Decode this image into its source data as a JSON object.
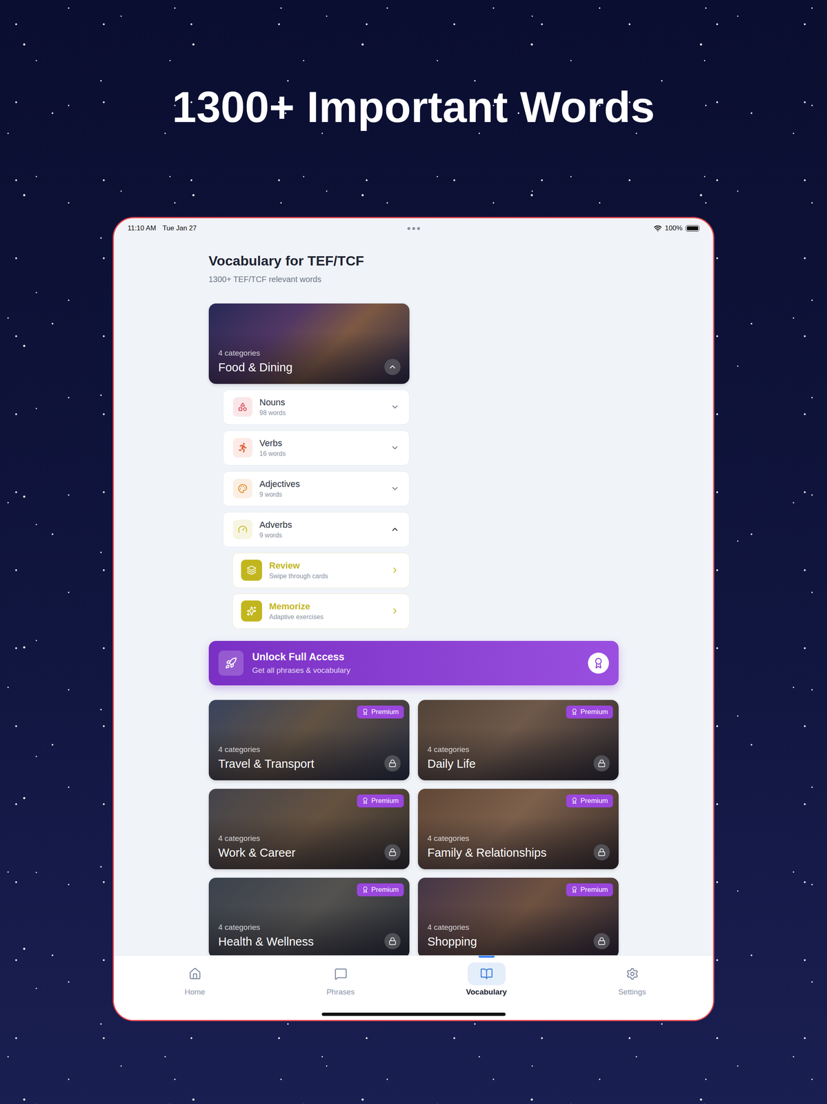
{
  "headline": "1300+ Important Words",
  "status_bar": {
    "time": "11:10 AM",
    "date": "Tue Jan 27",
    "battery": "100%",
    "battery_level": 1
  },
  "page": {
    "title": "Vocabulary for TEF/TCF",
    "subtitle": "1300+ TEF/TCF relevant words"
  },
  "featured": {
    "count": "4 categories",
    "title": "Food & Dining",
    "expanded": true,
    "groups": [
      {
        "name": "Nouns",
        "count": "98 words",
        "expanded": false,
        "color": "#d9434f"
      },
      {
        "name": "Verbs",
        "count": "16 words",
        "expanded": false,
        "color": "#e0603a"
      },
      {
        "name": "Adjectives",
        "count": "9 words",
        "expanded": false,
        "color": "#df8a2a"
      },
      {
        "name": "Adverbs",
        "count": "9 words",
        "expanded": true,
        "color": "#c2b61f"
      }
    ],
    "actions": [
      {
        "title": "Review",
        "subtitle": "Swipe through cards"
      },
      {
        "title": "Memorize",
        "subtitle": "Adaptive exercises"
      }
    ]
  },
  "banner": {
    "title": "Unlock Full Access",
    "subtitle": "Get all phrases & vocabulary"
  },
  "categories": [
    {
      "count": "4 categories",
      "title": "Travel & Transport",
      "badge": "Premium",
      "locked": true
    },
    {
      "count": "4 categories",
      "title": "Daily Life",
      "badge": "Premium",
      "locked": true
    },
    {
      "count": "4 categories",
      "title": "Work & Career",
      "badge": "Premium",
      "locked": true
    },
    {
      "count": "4 categories",
      "title": "Family & Relationships",
      "badge": "Premium",
      "locked": true
    },
    {
      "count": "4 categories",
      "title": "Health & Wellness",
      "badge": "Premium",
      "locked": true
    },
    {
      "count": "4 categories",
      "title": "Shopping",
      "badge": "Premium",
      "locked": true
    }
  ],
  "tabs": [
    {
      "label": "Home",
      "selected": false
    },
    {
      "label": "Phrases",
      "selected": false
    },
    {
      "label": "Vocabulary",
      "selected": true
    },
    {
      "label": "Settings",
      "selected": false
    }
  ]
}
